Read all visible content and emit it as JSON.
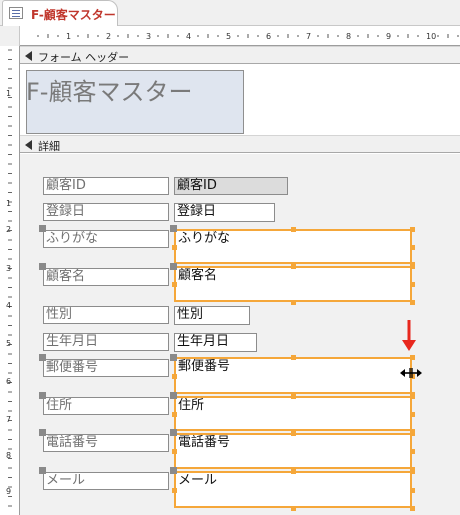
{
  "tab": {
    "title": "F-顧客マスター",
    "icon": "form-icon"
  },
  "ruler": {
    "h_numbers": [
      "1",
      "2",
      "3",
      "4",
      "5",
      "6",
      "7",
      "8",
      "9",
      "10",
      "11"
    ],
    "v_numbers": [
      "1",
      "1",
      "2",
      "3",
      "4",
      "5",
      "6",
      "7",
      "8",
      "9"
    ]
  },
  "sections": {
    "header_label": "フォーム ヘッダー",
    "detail_label": "詳細"
  },
  "header": {
    "title": "F-顧客マスター"
  },
  "fields": [
    {
      "label": "顧客ID",
      "value": "顧客ID"
    },
    {
      "label": "登録日",
      "value": "登録日"
    },
    {
      "label": "ふりがな",
      "value": "ふりがな"
    },
    {
      "label": "顧客名",
      "value": "顧客名"
    },
    {
      "label": "性別",
      "value": "性別"
    },
    {
      "label": "生年月日",
      "value": "生年月日"
    },
    {
      "label": "郵便番号",
      "value": "郵便番号"
    },
    {
      "label": "住所",
      "value": "住所"
    },
    {
      "label": "電話番号",
      "value": "電話番号"
    },
    {
      "label": "メール",
      "value": "メール"
    }
  ],
  "colors": {
    "selection": "#f5a73a",
    "annotation_arrow": "#e8281e",
    "tab_text": "#c0362c"
  },
  "cursor": "horizontal-resize-cursor"
}
